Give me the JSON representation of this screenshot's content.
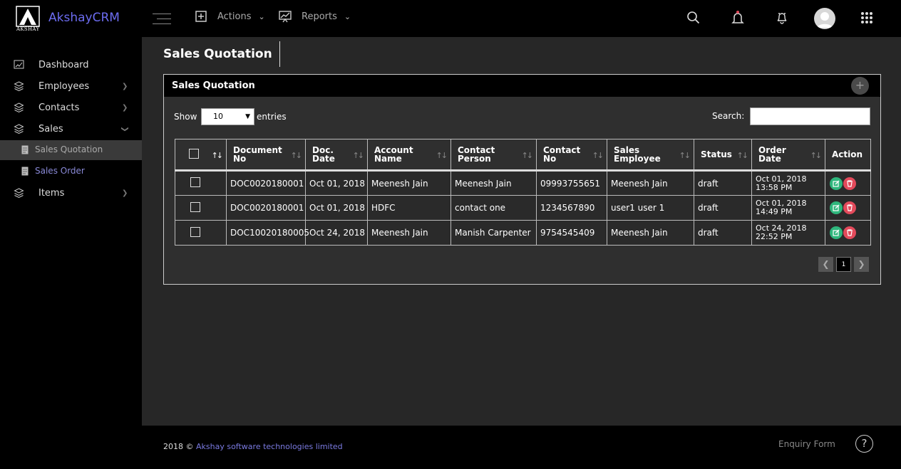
{
  "app": {
    "brand": "AkshayCRM",
    "logo_text": "AKSHAY"
  },
  "topnav": {
    "actions_label": "Actions",
    "reports_label": "Reports"
  },
  "sidebar": {
    "items": [
      {
        "label": "Dashboard"
      },
      {
        "label": "Employees"
      },
      {
        "label": "Contacts"
      },
      {
        "label": "Sales"
      },
      {
        "label": "Items"
      }
    ],
    "sub_items": [
      {
        "label": "Sales Quotation"
      },
      {
        "label": "Sales Order"
      }
    ]
  },
  "page": {
    "title": "Sales Quotation"
  },
  "panel": {
    "title": "Sales Quotation",
    "show_label": "Show",
    "entries_value": "10",
    "entries_label": "entries",
    "search_label": "Search:",
    "search_value": ""
  },
  "table": {
    "headers": {
      "doc_no_1": "Document",
      "doc_no_2": "No",
      "doc_date_1": "Doc.",
      "doc_date_2": "Date",
      "account_1": "Account",
      "account_2": "Name",
      "contact_1": "Contact",
      "contact_2": "Person",
      "contact_no_1": "Contact",
      "contact_no_2": "No",
      "employee_1": "Sales",
      "employee_2": "Employee",
      "status": "Status",
      "order_date_1": "Order",
      "order_date_2": "Date",
      "action": "Action"
    },
    "rows": [
      {
        "doc_no": "DOC0020180001",
        "doc_date": "Oct 01, 2018",
        "account": "Meenesh Jain",
        "contact": "Meenesh Jain",
        "contact_no": "09993755651",
        "employee": "Meenesh Jain",
        "status": "draft",
        "order_date_1": "Oct 01, 2018",
        "order_date_2": "13:58 PM"
      },
      {
        "doc_no": "DOC0020180001",
        "doc_date": "Oct 01, 2018",
        "account": "HDFC",
        "contact": "contact one",
        "contact_no": "1234567890",
        "employee": "user1 user 1",
        "status": "draft",
        "order_date_1": "Oct 01, 2018",
        "order_date_2": "14:49 PM"
      },
      {
        "doc_no": "DOC10020180005",
        "doc_date": "Oct 24, 2018",
        "account": "Meenesh Jain",
        "contact": "Manish Carpenter",
        "contact_no": "9754545409",
        "employee": "Meenesh Jain",
        "status": "draft",
        "order_date_1": "Oct 24, 2018",
        "order_date_2": "22:52 PM"
      }
    ]
  },
  "pagination": {
    "current": "1"
  },
  "footer": {
    "year": "2018 ©",
    "company": "Akshay software technologies limited",
    "enquiry": "Enquiry Form",
    "help": "?"
  },
  "colors": {
    "brand": "#6c6cf0",
    "edit_button": "#2fb67c",
    "delete_button": "#e34a5b"
  },
  "icons": [
    "menu-icon",
    "actions-icon",
    "reports-icon",
    "search-icon",
    "bell-icon",
    "notification-icon",
    "avatar",
    "apps-grid-icon",
    "dashboard-icon",
    "layers-icon",
    "edit-icon",
    "delete-icon",
    "help-icon"
  ]
}
